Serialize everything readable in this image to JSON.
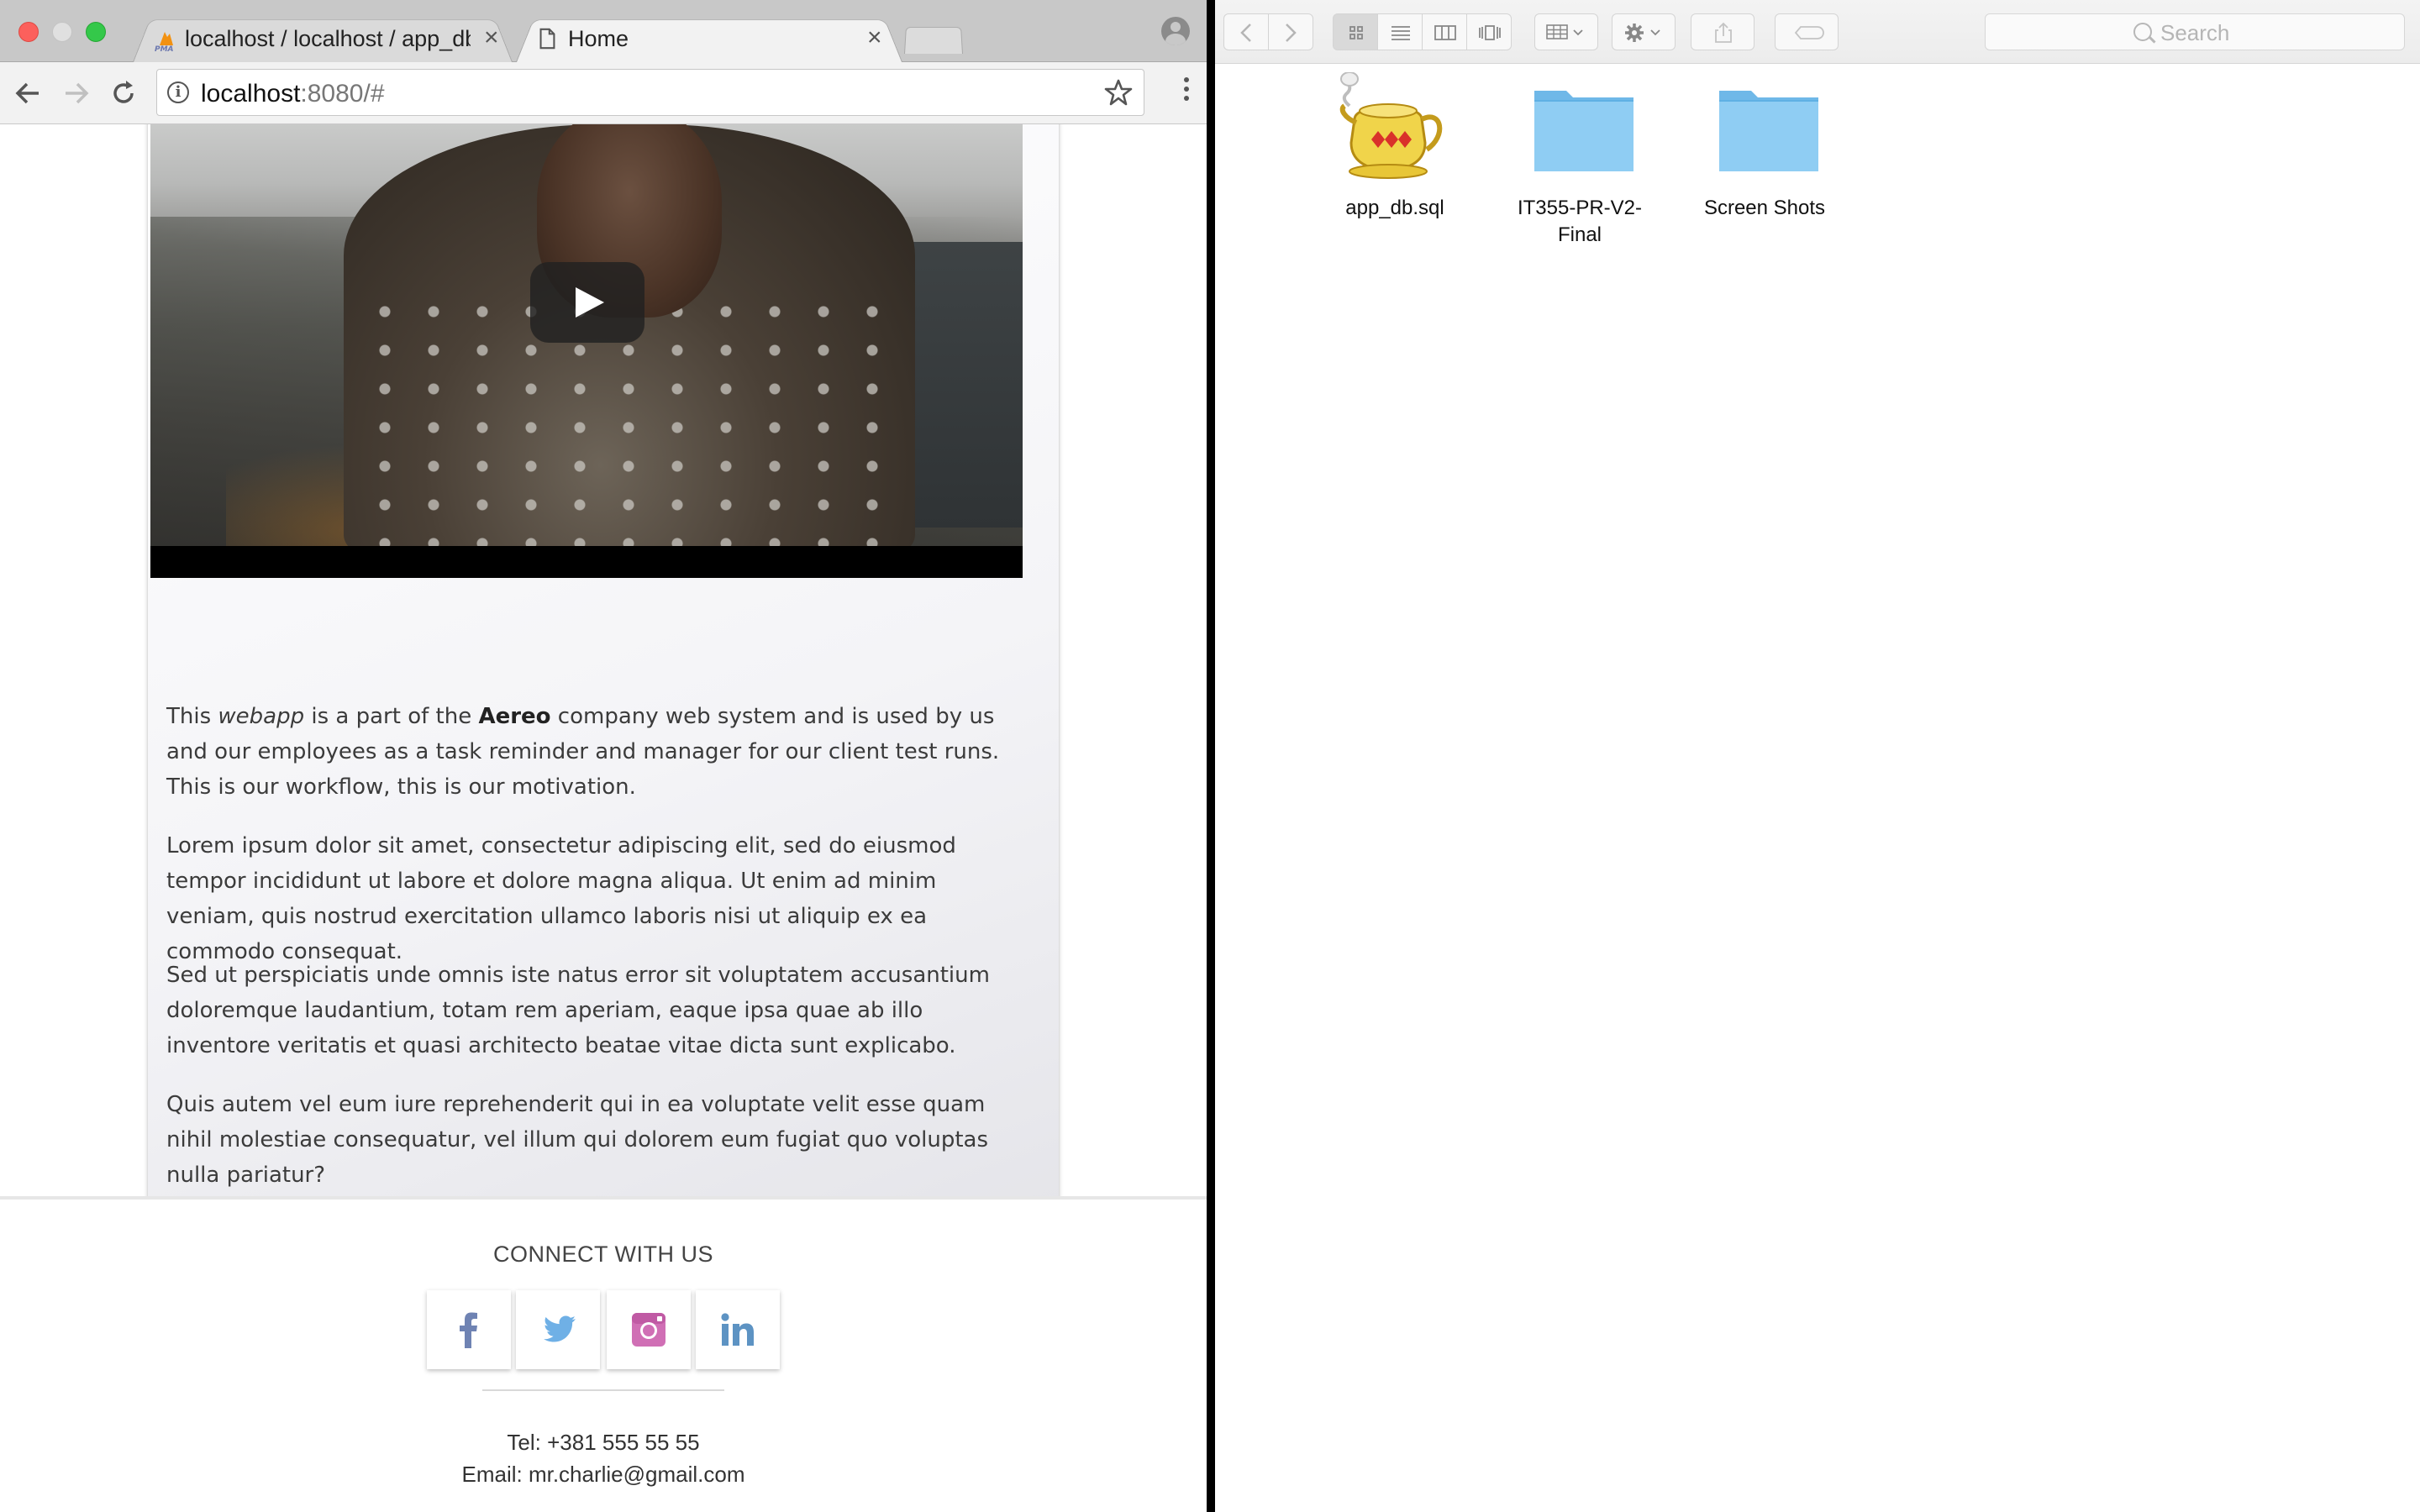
{
  "browser": {
    "tabs": [
      {
        "title": "localhost / localhost / app_db |"
      },
      {
        "title": "Home"
      }
    ],
    "tab_close": "×",
    "favicon_text": "PMA",
    "url_host": "localhost",
    "url_rest": ":8080/#"
  },
  "page": {
    "paragraphs": {
      "p1": {
        "pre": "This ",
        "em": "webapp",
        "mid": " is a part of the ",
        "strong": "Aereo",
        "post": " company web system and is used by us and our employees as a task reminder and manager for our client test runs. This is our workflow, this is our motivation."
      },
      "p2": "Lorem ipsum dolor sit amet, consectetur adipiscing elit, sed do eiusmod tempor incididunt ut labore et dolore magna aliqua. Ut enim ad minim veniam, quis nostrud exercitation ullamco laboris nisi ut aliquip ex ea commodo consequat.",
      "p3": "Sed ut perspiciatis unde omnis iste natus error sit voluptatem accusantium doloremque laudantium, totam rem aperiam, eaque ipsa quae ab illo inventore veritatis et quasi architecto beatae vitae dicta sunt explicabo.",
      "p4": "Quis autem vel eum iure reprehenderit qui in ea voluptate velit esse quam nihil molestiae consequatur, vel illum qui dolorem eum fugiat quo voluptas nulla pariatur?"
    },
    "footer": {
      "connect_title": "CONNECT WITH US",
      "social": [
        {
          "icon": "facebook-icon",
          "color": "#6f83b3"
        },
        {
          "icon": "twitter-icon",
          "color": "#6fb0e6"
        },
        {
          "icon": "instagram-icon",
          "color": "#d06fb5"
        },
        {
          "icon": "linkedin-icon",
          "color": "#5d93c3"
        }
      ],
      "tel": "Tel: +381 555 55 55",
      "email": "Email: mr.charlie@gmail.com"
    }
  },
  "finder": {
    "search_placeholder": "Search",
    "items": [
      {
        "name": "app_db.sql",
        "icon": "sql-file-icon"
      },
      {
        "name": "IT355-PR-V2-Final",
        "icon": "folder-icon"
      },
      {
        "name": "Screen Shots",
        "icon": "folder-icon"
      }
    ],
    "folder_color": "#86c8f0"
  }
}
